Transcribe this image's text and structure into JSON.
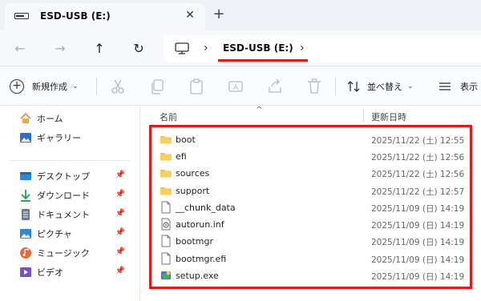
{
  "tab": {
    "title": "ESD-USB (E:)",
    "close": "✕",
    "new_tab": "+"
  },
  "nav": {
    "back": "←",
    "forward": "→",
    "up": "↑",
    "refresh": "↻"
  },
  "address": {
    "separator": "›",
    "crumb": "ESD-USB (E:)"
  },
  "toolbar": {
    "new_label": "新規作成",
    "sort_label": "並べ替え",
    "view_label": "表示",
    "chevron": "⌄"
  },
  "sidebar": {
    "quick": [
      {
        "label": "ホーム",
        "icon": "home-icon"
      },
      {
        "label": "ギャラリー",
        "icon": "gallery-icon"
      }
    ],
    "pinned": [
      {
        "label": "デスクトップ",
        "icon": "desktop-icon"
      },
      {
        "label": "ダウンロード",
        "icon": "download-icon"
      },
      {
        "label": "ドキュメント",
        "icon": "documents-icon"
      },
      {
        "label": "ピクチャ",
        "icon": "pictures-icon"
      },
      {
        "label": "ミュージック",
        "icon": "music-icon"
      },
      {
        "label": "ビデオ",
        "icon": "videos-icon"
      }
    ]
  },
  "columns": {
    "name": "名前",
    "date": "更新日時"
  },
  "files": [
    {
      "name": "boot",
      "date": "2025/11/22 (土) 12:55",
      "type": "folder"
    },
    {
      "name": "efi",
      "date": "2025/11/22 (土) 12:56",
      "type": "folder"
    },
    {
      "name": "sources",
      "date": "2025/11/22 (土) 12:56",
      "type": "folder"
    },
    {
      "name": "support",
      "date": "2025/11/22 (土) 12:57",
      "type": "folder"
    },
    {
      "name": "__chunk_data",
      "date": "2025/11/09 (日) 14:19",
      "type": "file"
    },
    {
      "name": "autorun.inf",
      "date": "2025/11/09 (日) 14:19",
      "type": "settings-file"
    },
    {
      "name": "bootmgr",
      "date": "2025/11/09 (日) 14:19",
      "type": "file"
    },
    {
      "name": "bootmgr.efi",
      "date": "2025/11/09 (日) 14:19",
      "type": "file"
    },
    {
      "name": "setup.exe",
      "date": "2025/11/09 (日) 14:19",
      "type": "setup-exe"
    }
  ],
  "colors": {
    "highlight": "#e01b1b",
    "folder": "#f4c542"
  }
}
